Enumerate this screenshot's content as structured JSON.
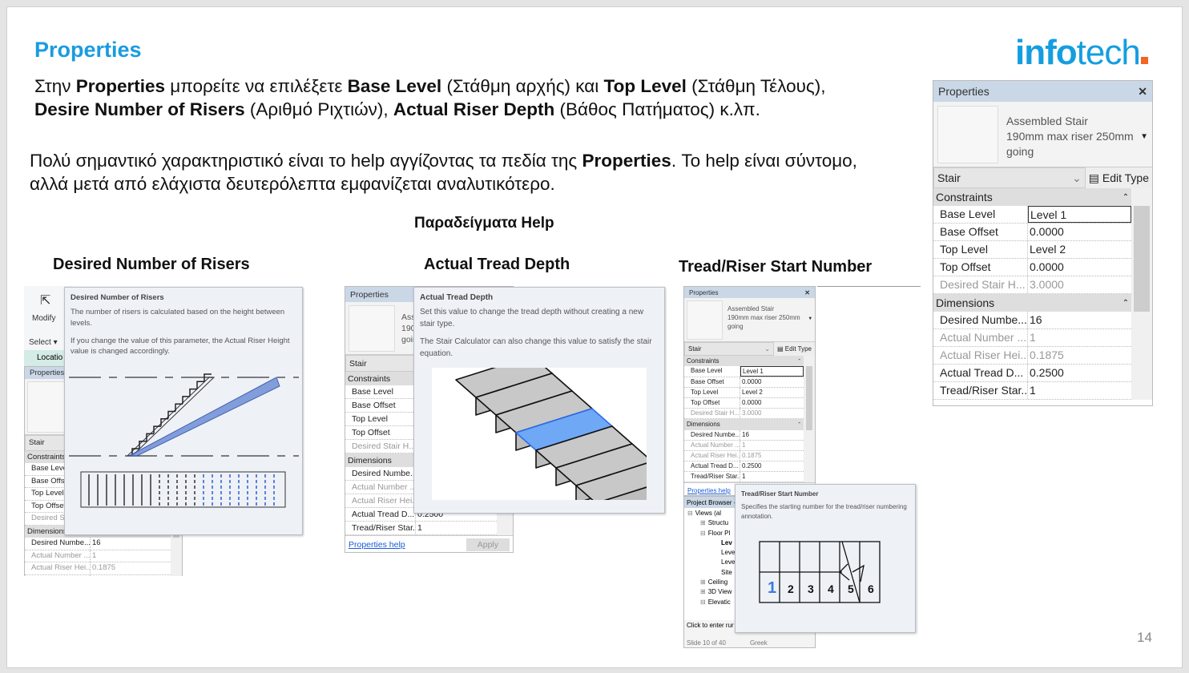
{
  "slide": {
    "title": "Properties",
    "logo_text": "infotech",
    "paragraph1": [
      {
        "t": "Στην ",
        "b": false
      },
      {
        "t": "Properties",
        "b": true
      },
      {
        "t": " μπορείτε να επιλέξετε ",
        "b": false
      },
      {
        "t": "Base Level",
        "b": true
      },
      {
        "t": " (Στάθμη αρχής) και ",
        "b": false
      },
      {
        "t": "Top Level",
        "b": true
      },
      {
        "t": " (Στάθμη Τέλους), ",
        "b": false
      },
      {
        "t": "Desire Number of Risers",
        "b": true
      },
      {
        "t": " (Αριθμό  Ριχτιών), ",
        "b": false
      },
      {
        "t": "Actual Riser Depth",
        "b": true
      },
      {
        "t": " (Βάθος Πατήματος) κ.λπ.",
        "b": false
      }
    ],
    "paragraph2": [
      {
        "t": "Πολύ σημαντικό χαρακτηριστικό είναι το help αγγίζοντας τα πεδία της ",
        "b": false
      },
      {
        "t": "Properties",
        "b": true
      },
      {
        "t": ". Το help είναι σύντομο, αλλά μετά από ελάχιστα δευτερόλεπτα εμφανίζεται αναλυτικότερο.",
        "b": false
      }
    ],
    "examples_heading": "Παραδείγματα  Help",
    "example_titles": [
      "Desired Number of Risers",
      "Actual Tread Depth",
      "Tread/Riser Start Number"
    ],
    "page_number": "14"
  },
  "properties_panel": {
    "header": "Properties",
    "close_icon": "close-icon",
    "type_line1": "Assembled Stair",
    "type_line2": "190mm max riser 250mm",
    "type_line3": "going",
    "category": "Stair",
    "edit_type": "Edit Type",
    "groups": [
      {
        "name": "Constraints",
        "rows": [
          {
            "label": "Base Level",
            "value": "Level 1",
            "disabled": false,
            "selected": true
          },
          {
            "label": "Base Offset",
            "value": "0.0000",
            "disabled": false
          },
          {
            "label": "Top Level",
            "value": "Level 2",
            "disabled": false
          },
          {
            "label": "Top Offset",
            "value": "0.0000",
            "disabled": false
          },
          {
            "label": "Desired Stair H...",
            "value": "3.0000",
            "disabled": true
          }
        ]
      },
      {
        "name": "Dimensions",
        "rows": [
          {
            "label": "Desired Numbe...",
            "value": "16",
            "disabled": false
          },
          {
            "label": "Actual Number ...",
            "value": "1",
            "disabled": true
          },
          {
            "label": "Actual Riser Hei...",
            "value": "0.1875",
            "disabled": true
          },
          {
            "label": "Actual Tread D...",
            "value": "0.2500",
            "disabled": false
          },
          {
            "label": "Tread/Riser Star...",
            "value": "1",
            "disabled": false
          }
        ]
      }
    ],
    "properties_help": "Properties help",
    "apply": "Apply"
  },
  "ribbon": {
    "modify": "Modify",
    "select": "Select ▾",
    "location": "Locatio"
  },
  "tooltips": [
    {
      "title": "Desired Number of Risers",
      "lines": [
        "The number of risers is calculated based on the height between levels.",
        "If you change the value of this parameter, the Actual Riser Height value is changed accordingly."
      ]
    },
    {
      "title": "Actual Tread Depth",
      "lines": [
        "Set this value to change the tread depth without creating a new stair type.",
        "The Stair Calculator can also change this value to satisfy the stair equation."
      ]
    },
    {
      "title": "Tread/Riser Start Number",
      "lines": [
        "Specifies the starting number for the tread/riser numbering annotation."
      ],
      "numbers": [
        "1",
        "2",
        "3",
        "4",
        "5",
        "6"
      ]
    }
  ],
  "project_browser": {
    "header": "Project Browser -",
    "items": [
      "Views (al",
      "Structu",
      "Floor Pl",
      "Lev",
      "Leve",
      "Leve",
      "Site",
      "Ceiling",
      "3D View",
      "Elevatic"
    ],
    "status": "Click to enter rur",
    "slide_status": "Slide 10 of 40",
    "language": "Greek"
  },
  "colors": {
    "accent": "#1a9be0",
    "logo_dot": "#f26522",
    "highlight": "#6fa8f5"
  }
}
